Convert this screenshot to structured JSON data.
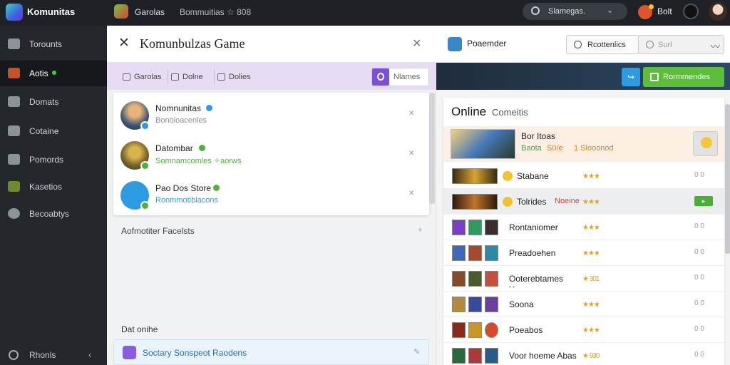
{
  "topbar": {
    "brand": "Komunitas",
    "nav": [
      "Garolas",
      "Bommuitias ☆ 808"
    ],
    "search_placeholder": "Slamegas.",
    "user": "Bolt",
    "icons": [
      "app-logo-icon",
      "game-icon",
      "search-icon",
      "chevron-down-icon",
      "fire-icon",
      "avatar-dark-icon",
      "avatar-user-icon"
    ]
  },
  "sidebar": {
    "items": [
      {
        "label": "Torounts",
        "icon": "list-icon"
      },
      {
        "label": "Aotis",
        "icon": "game-tile-icon",
        "active": true
      },
      {
        "label": "Domats",
        "icon": "puzzle-icon"
      },
      {
        "label": "Cotaine",
        "icon": "person-icon"
      },
      {
        "label": "Pomords",
        "icon": "monitor-icon"
      },
      {
        "label": "Kasetios",
        "icon": "character-icon"
      },
      {
        "label": "Becoabtys",
        "icon": "badge-icon"
      }
    ],
    "bottom_label": "Rhonls"
  },
  "dialog": {
    "title": "Komunbulzas Game",
    "tabs": [
      "Garolas",
      "Dolne",
      "Dolies"
    ],
    "search_placeholder": "Nlames",
    "friends": [
      {
        "name": "Nomnunitas",
        "status": "Bonoioacenles",
        "status_color": "#8e8e8e",
        "badge": "#2d9be0",
        "verified": "#2d9be0",
        "action": "✕"
      },
      {
        "name": "Datombar",
        "status": "Somnamcomles ✧aorws",
        "status_color": "#4db13b",
        "badge": "#4db13b",
        "verified": "#4db13b",
        "action": "✕"
      },
      {
        "name": "Pao Dos Store",
        "status": "Ronmmotiblacons",
        "status_color": "#2a9fd0",
        "badge": "#4db13b",
        "verified": "#4db13b",
        "action": "✕"
      }
    ],
    "section_1": "Aofmotiter Facelsts",
    "section_1_plus": "+",
    "section_2": "Dat onihe",
    "notification": "Soctary Sonspeot Raodens"
  },
  "right_panel": {
    "title": "Poaemder",
    "button_1": "Rcottenlics",
    "button_2_placeholder": "Surl",
    "banner_button": "Rormmendes",
    "online_title": "Online",
    "online_sub": "Comeitis",
    "featured": {
      "name": "Bor Itoas",
      "sub_green": "Baota",
      "sub_orange": "S0/e",
      "sub_yellow": "1 Slooonod"
    },
    "games": [
      {
        "name": "Stabane",
        "stars": "★★★",
        "page": "0 0"
      },
      {
        "name": "Tolrides",
        "tag": "Noeine",
        "stars": "★★★",
        "page": "▸",
        "highlight": true
      },
      {
        "name": "Rontaniomer",
        "stars": "★★★",
        "page": "0 0"
      },
      {
        "name": "Preadoehen",
        "stars": "★★★",
        "page": "0 0"
      },
      {
        "name": "Ooterebtames",
        "stars": "★ 301",
        "page": "0 0",
        "dots": "• •"
      },
      {
        "name": "Soona",
        "stars": "★★★",
        "page": "0 0"
      },
      {
        "name": "Poeabos",
        "stars": "★★★",
        "page": "0 0"
      },
      {
        "name": "Voor hoeme Abas",
        "stars": "★ 930",
        "page": "0 0"
      }
    ]
  }
}
